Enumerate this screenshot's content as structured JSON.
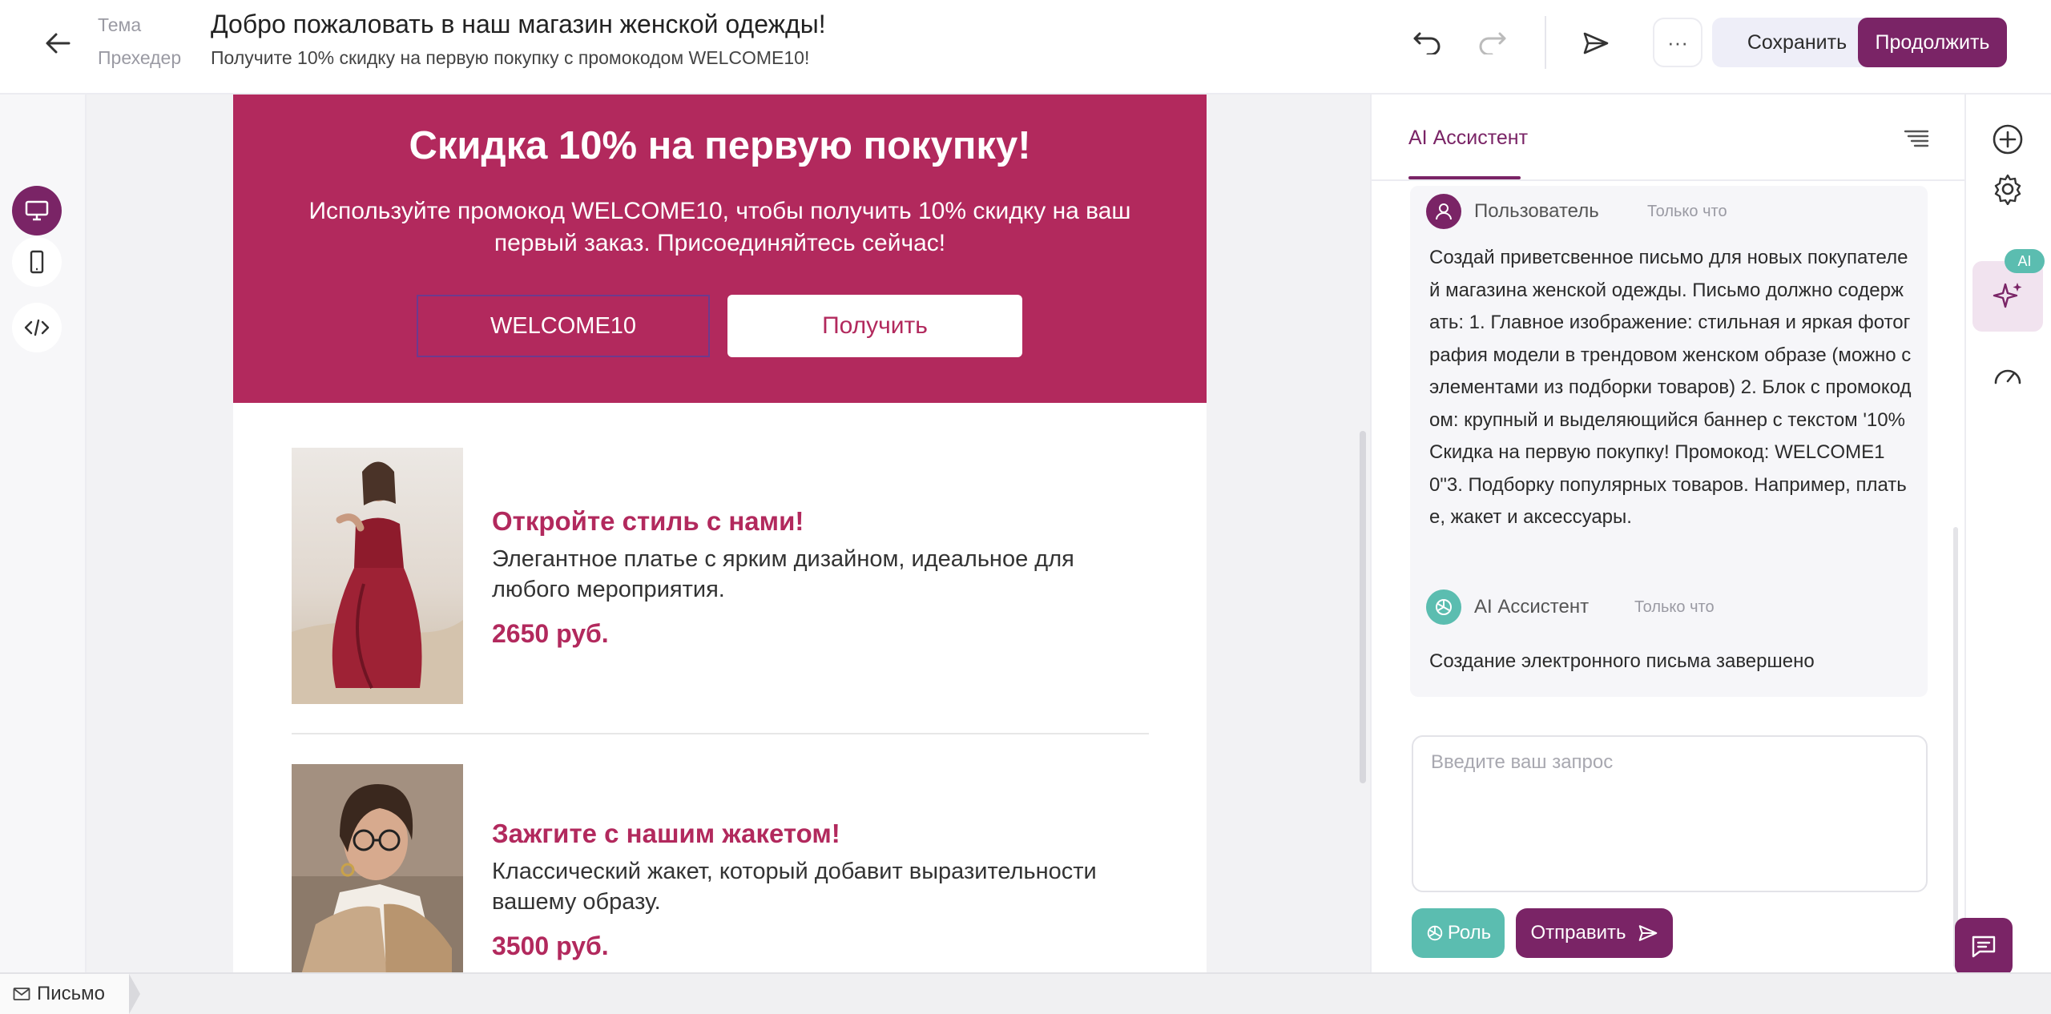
{
  "header": {
    "theme_label": "Тема",
    "preheader_label": "Прехедер",
    "subject": "Добро пожаловать в наш магазин женской одежды!",
    "preheader": "Получите 10% скидку на первую покупку с промокодом WELCOME10!",
    "more_label": "···",
    "save_label": "Сохранить",
    "continue_label": "Продолжить"
  },
  "email": {
    "banner": {
      "title": "Скидка 10% на первую покупку!",
      "text": "Используйте промокод WELCOME10, чтобы получить 10% скидку на ваш первый заказ. Присоединяйтесь сейчас!",
      "code": "WELCOME10",
      "button": "Получить"
    },
    "products": [
      {
        "title": "Откройте стиль с нами!",
        "description": "Элегантное платье с ярким дизайном, идеальное для любого мероприятия.",
        "price": "2650 руб."
      },
      {
        "title": "Зажгите с нашим жакетом!",
        "description": "Классический жакет, который добавит выразительности вашему образу.",
        "price": "3500 руб."
      }
    ]
  },
  "ai_panel": {
    "tab_label": "AI Ассистент",
    "messages": [
      {
        "author": "Пользователь",
        "time": "Только что",
        "text": "Создай приветсвенное письмо для новых покупателей магазина женской одежды. Письмо должно содержать: 1. Главное изображение: стильная и яркая фотография модели в трендовом женском образе (можно с элементами из подборки товаров) 2. Блок с промокодом: крупный и выделяющийся баннер с текстом '10% Скидка на первую покупку! Промокод: WELCOME10\"3. Подборку популярных товаров. Например, платье, жакет и аксессуары."
      },
      {
        "author": "AI Ассистент",
        "time": "Только что",
        "text": "Создание электронного письма завершено"
      }
    ],
    "input_placeholder": "Введите ваш запрос",
    "role_label": "Роль",
    "send_label": "Отправить"
  },
  "right_rail": {
    "ai_badge": "AI"
  },
  "footer": {
    "breadcrumb": "Письмо"
  },
  "colors": {
    "brand": "#7a2466",
    "banner": "#b2295d",
    "teal": "#5bbdb0"
  },
  "icons": [
    "back-arrow-icon",
    "undo-icon",
    "redo-icon",
    "send-icon",
    "more-icon",
    "desktop-icon",
    "mobile-icon",
    "code-icon",
    "menu-lines-icon",
    "user-icon",
    "openai-icon",
    "plus-circle-icon",
    "gear-icon",
    "sparkle-icon",
    "gauge-icon",
    "chat-icon",
    "mail-icon"
  ]
}
